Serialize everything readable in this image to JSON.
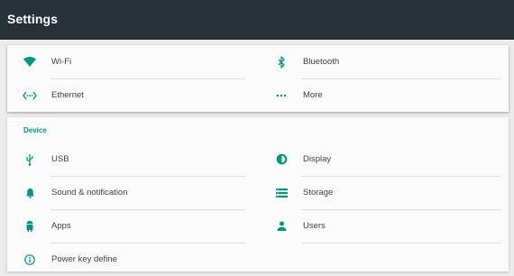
{
  "toolbar": {
    "title": "Settings"
  },
  "colors": {
    "accent": "#009688",
    "toolbar": "#263238"
  },
  "top": {
    "items": [
      {
        "label": "Wi-Fi",
        "icon": "wifi-icon"
      },
      {
        "label": "Bluetooth",
        "icon": "bluetooth-icon"
      },
      {
        "label": "Ethernet",
        "icon": "ethernet-icon"
      },
      {
        "label": "More",
        "icon": "more-icon"
      }
    ]
  },
  "device": {
    "category": "Device",
    "items": [
      {
        "label": "USB",
        "icon": "usb-icon"
      },
      {
        "label": "Display",
        "icon": "display-icon"
      },
      {
        "label": "Sound & notification",
        "icon": "bell-icon"
      },
      {
        "label": "Storage",
        "icon": "storage-icon"
      },
      {
        "label": "Apps",
        "icon": "android-icon"
      },
      {
        "label": "Users",
        "icon": "person-icon"
      },
      {
        "label": "Power key define",
        "icon": "info-icon"
      }
    ]
  }
}
